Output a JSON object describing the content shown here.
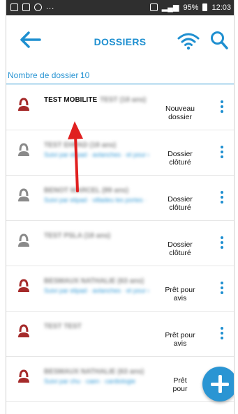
{
  "status_bar": {
    "left_icons": [
      "image-icon",
      "facebook-icon",
      "messenger-icon"
    ],
    "left_more": "...",
    "battery": "95%",
    "time": "12:03"
  },
  "app_bar": {
    "title": "DOSSIERS",
    "back_icon": "arrow-left-icon",
    "wifi_icon": "wifi-icon",
    "search_icon": "search-icon"
  },
  "dossier_count": {
    "label": "Nombre de dossier :",
    "value": "10"
  },
  "dossiers": [
    {
      "name": "TEST MOBILITE",
      "name_blurred": "TEST (18 ans)",
      "subtitle": "",
      "status": "Nouveau dossier",
      "icon_color": "#a52a2a",
      "icon": "person-icon"
    },
    {
      "name": "",
      "name_blurred": "TEST EHPAD (18 ans)",
      "subtitle": "Suivi par elipad · avlanches · et pour de test",
      "status": "Dossier clôturé",
      "icon_color": "#8a8a8a",
      "icon": "person-icon"
    },
    {
      "name": "",
      "name_blurred": "BENOT MARCEL (89 ans)",
      "subtitle": "Suivi par elipad · villadeu les portes · pue garat",
      "status": "Dossier clôturé",
      "icon_color": "#8a8a8a",
      "icon": "person-icon"
    },
    {
      "name": "",
      "name_blurred": "TEST PSLA (18 ans)",
      "subtitle": "",
      "status": "Dossier clôturé",
      "icon_color": "#8a8a8a",
      "icon": "person-icon"
    },
    {
      "name": "",
      "name_blurred": "BESMAUX NATHALIE (63 ans)",
      "subtitle": "Suivi par elipad · avlanches · et pour de test",
      "status": "Prêt pour avis",
      "icon_color": "#a52a2a",
      "icon": "person-icon"
    },
    {
      "name": "",
      "name_blurred": "TEST TEST",
      "subtitle": "",
      "status": "Prêt pour avis",
      "icon_color": "#a52a2a",
      "icon": "person-icon"
    },
    {
      "name": "",
      "name_blurred": "BESMAUX NATHALIE (63 ans)",
      "subtitle": "Suivi par chu · caen · cardiologie",
      "status": "Prêt pour",
      "icon_color": "#a52a2a",
      "icon": "person-icon"
    }
  ],
  "fab_icon": "plus-icon",
  "colors": {
    "accent": "#1e8fd0",
    "annotation": "#e02020"
  }
}
